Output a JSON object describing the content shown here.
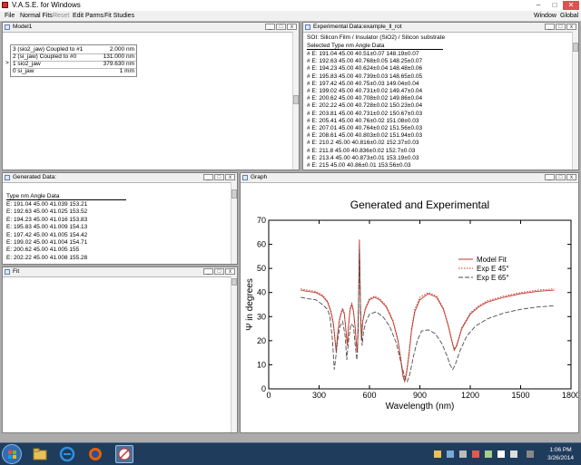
{
  "app": {
    "title": "V.A.S.E. for Windows",
    "menu": {
      "left": [
        "File",
        "Normal Fits",
        "Reset",
        "Edit Parms",
        "Fit Studies"
      ],
      "disabled": [
        "Reset"
      ],
      "right": [
        "Window",
        "Global"
      ]
    }
  },
  "model_window": {
    "title": "Model1",
    "layers": [
      {
        "marker": "",
        "text": "3  (sio2_jaw) Coupled to #1",
        "thickness": "2.000 nm"
      },
      {
        "marker": "",
        "text": "2  (si_jaw) Coupled to #0",
        "thickness": "131.000 nm"
      },
      {
        "marker": ">",
        "text": "1  sio2_jaw",
        "thickness": "379.630 nm"
      },
      {
        "marker": "",
        "text": "0  si_jaw",
        "thickness": "1 mm"
      }
    ]
  },
  "exp_window": {
    "title": "Experimental Data:example_ll_rot",
    "description": "SOI: Silicon Film / Insulator (SiO2) / Silicon substrate",
    "header": "Selected  Type   nm   Angle   Data",
    "rows": [
      "# E:  191.04   45.00   40.51±0.07   148.19±0.07",
      "# E:  192.63   45.00   40.768±0.05   148.25±0.07",
      "# E:  194.23   45.00   40.624±0.04   148.48±0.06",
      "# E:  195.83   45.00   40.739±0.03   148.65±0.05",
      "# E:  197.42   45.00   40.75±0.03   149.04±0.04",
      "# E:  199.02   45.00   40.731±0.02   149.47±0.04",
      "# E:  200.62   45.00   40.708±0.02   149.86±0.04",
      "# E:  202.22   45.00   40.728±0.02   150.23±0.04",
      "# E:  203.81   45.00   40.731±0.02   150.67±0.03",
      "# E:  205.41   45.00   40.76±0.02   151.08±0.03",
      "# E:  207.01   45.00   40.764±0.02   151.56±0.03",
      "# E:  208.61   45.00   40.803±0.02   151.94±0.03",
      "# E:  210.2   45.00   40.816±0.02   152.37±0.03",
      "# E:  211.8   45.00   40.836±0.02   152.7±0.03",
      "# E:  213.4   45.00   40.873±0.01   153.19±0.03",
      "# E:  215   45.00   40.86±0.01   153.56±0.03"
    ]
  },
  "generated_window": {
    "title": "Generated Data:",
    "header": "Type  nm   Angle  Data",
    "rows": [
      "E:  191.04  45.00  41.039  153.21",
      "E:  192.63  45.00  41.025  153.52",
      "E:  194.23  45.00  41.016  153.83",
      "E:  195.83  45.00  41.009  154.13",
      "E:  197.42  45.00  41.005  154.42",
      "E:  199.02  45.00  41.004  154.71",
      "E:  200.62  45.00  41.005  155",
      "E:  202.22  45.00  41.008  155.28"
    ]
  },
  "fit_window": {
    "title": "Fit"
  },
  "graph_window": {
    "title": "Graph"
  },
  "chart_data": {
    "type": "line",
    "title": "Generated and Experimental",
    "xlabel": "Wavelength (nm)",
    "ylabel": "Ψ in degrees",
    "xlim": [
      0,
      1800
    ],
    "ylim": [
      0,
      70
    ],
    "xticks": [
      0,
      300,
      600,
      900,
      1200,
      1500,
      1800
    ],
    "yticks": [
      0,
      10,
      20,
      30,
      40,
      50,
      60,
      70
    ],
    "legend_position": "right",
    "grid": false,
    "series": [
      {
        "name": "Model Fit",
        "color": "#c0392b",
        "style": "solid",
        "points": [
          [
            191,
            41
          ],
          [
            230,
            40.5
          ],
          [
            280,
            40
          ],
          [
            320,
            38.5
          ],
          [
            350,
            36
          ],
          [
            370,
            32
          ],
          [
            385,
            27
          ],
          [
            395,
            20
          ],
          [
            402,
            15
          ],
          [
            410,
            22
          ],
          [
            420,
            28
          ],
          [
            430,
            31
          ],
          [
            440,
            33
          ],
          [
            450,
            31
          ],
          [
            460,
            24
          ],
          [
            468,
            18
          ],
          [
            475,
            26
          ],
          [
            485,
            33
          ],
          [
            495,
            35
          ],
          [
            505,
            32
          ],
          [
            515,
            25
          ],
          [
            522,
            18
          ],
          [
            528,
            15
          ],
          [
            534,
            32
          ],
          [
            540,
            62
          ],
          [
            546,
            35
          ],
          [
            552,
            20
          ],
          [
            560,
            28
          ],
          [
            575,
            33
          ],
          [
            600,
            37
          ],
          [
            630,
            38
          ],
          [
            660,
            37
          ],
          [
            700,
            34
          ],
          [
            740,
            28
          ],
          [
            770,
            20
          ],
          [
            790,
            10
          ],
          [
            800,
            5
          ],
          [
            810,
            3
          ],
          [
            820,
            6
          ],
          [
            835,
            14
          ],
          [
            850,
            24
          ],
          [
            870,
            32
          ],
          [
            900,
            37
          ],
          [
            950,
            39.5
          ],
          [
            1000,
            38
          ],
          [
            1040,
            33
          ],
          [
            1070,
            26
          ],
          [
            1090,
            20
          ],
          [
            1105,
            16
          ],
          [
            1120,
            18
          ],
          [
            1150,
            25
          ],
          [
            1200,
            31
          ],
          [
            1250,
            34
          ],
          [
            1300,
            36
          ],
          [
            1400,
            38
          ],
          [
            1500,
            39.5
          ],
          [
            1600,
            40.5
          ],
          [
            1700,
            41
          ]
        ]
      },
      {
        "name": "Exp E 45°",
        "color": "#c0392b",
        "style": "dotted",
        "points": [
          [
            191,
            41.5
          ],
          [
            230,
            41
          ],
          [
            280,
            40.5
          ],
          [
            320,
            39
          ],
          [
            350,
            36.5
          ],
          [
            370,
            32.5
          ],
          [
            385,
            27.5
          ],
          [
            395,
            21
          ],
          [
            402,
            16
          ],
          [
            410,
            22.5
          ],
          [
            420,
            28.5
          ],
          [
            430,
            31.5
          ],
          [
            440,
            33.5
          ],
          [
            450,
            31.5
          ],
          [
            460,
            24.5
          ],
          [
            468,
            18.5
          ],
          [
            475,
            26.5
          ],
          [
            485,
            33.5
          ],
          [
            495,
            35.5
          ],
          [
            505,
            32.5
          ],
          [
            515,
            25.5
          ],
          [
            522,
            18.5
          ],
          [
            528,
            15.5
          ],
          [
            534,
            32.5
          ],
          [
            540,
            61
          ],
          [
            546,
            35.5
          ],
          [
            552,
            20.5
          ],
          [
            560,
            28.5
          ],
          [
            575,
            33.5
          ],
          [
            600,
            37.5
          ],
          [
            630,
            38.5
          ],
          [
            660,
            37.5
          ],
          [
            700,
            34.5
          ],
          [
            740,
            28.5
          ],
          [
            770,
            20.5
          ],
          [
            790,
            11
          ],
          [
            800,
            6
          ],
          [
            810,
            4
          ],
          [
            820,
            7
          ],
          [
            835,
            15
          ],
          [
            850,
            25
          ],
          [
            870,
            33
          ],
          [
            900,
            38
          ],
          [
            950,
            40
          ],
          [
            1000,
            38.5
          ],
          [
            1040,
            33.5
          ],
          [
            1070,
            26.5
          ],
          [
            1090,
            20.5
          ],
          [
            1105,
            16.5
          ],
          [
            1120,
            18.5
          ],
          [
            1150,
            25.5
          ],
          [
            1200,
            31.5
          ],
          [
            1250,
            34.5
          ],
          [
            1300,
            36.5
          ],
          [
            1400,
            38.5
          ],
          [
            1500,
            40
          ],
          [
            1600,
            41
          ],
          [
            1700,
            41.5
          ]
        ]
      },
      {
        "name": "Exp E 65°",
        "color": "#4d4d4d",
        "style": "dashed",
        "points": [
          [
            191,
            38
          ],
          [
            230,
            37.5
          ],
          [
            280,
            37
          ],
          [
            320,
            35
          ],
          [
            350,
            33
          ],
          [
            365,
            30
          ],
          [
            380,
            20
          ],
          [
            390,
            8
          ],
          [
            398,
            12
          ],
          [
            410,
            20
          ],
          [
            425,
            26
          ],
          [
            440,
            28
          ],
          [
            455,
            22
          ],
          [
            465,
            12
          ],
          [
            475,
            20
          ],
          [
            490,
            27
          ],
          [
            505,
            26
          ],
          [
            515,
            18
          ],
          [
            525,
            12
          ],
          [
            533,
            25
          ],
          [
            540,
            58
          ],
          [
            548,
            30
          ],
          [
            556,
            18
          ],
          [
            565,
            24
          ],
          [
            580,
            28
          ],
          [
            600,
            31
          ],
          [
            640,
            32
          ],
          [
            680,
            30
          ],
          [
            720,
            26
          ],
          [
            760,
            19
          ],
          [
            790,
            10
          ],
          [
            810,
            5
          ],
          [
            825,
            3
          ],
          [
            840,
            6
          ],
          [
            860,
            13
          ],
          [
            885,
            20
          ],
          [
            910,
            24
          ],
          [
            950,
            24.5
          ],
          [
            990,
            23
          ],
          [
            1030,
            19
          ],
          [
            1060,
            14
          ],
          [
            1080,
            10
          ],
          [
            1095,
            8
          ],
          [
            1110,
            10
          ],
          [
            1140,
            16
          ],
          [
            1180,
            22
          ],
          [
            1230,
            26
          ],
          [
            1300,
            29
          ],
          [
            1400,
            31.5
          ],
          [
            1500,
            33
          ],
          [
            1600,
            34
          ],
          [
            1700,
            34.5
          ]
        ]
      }
    ]
  },
  "taskbar": {
    "clock_time": "1:06 PM",
    "clock_date": "3/26/2014"
  }
}
